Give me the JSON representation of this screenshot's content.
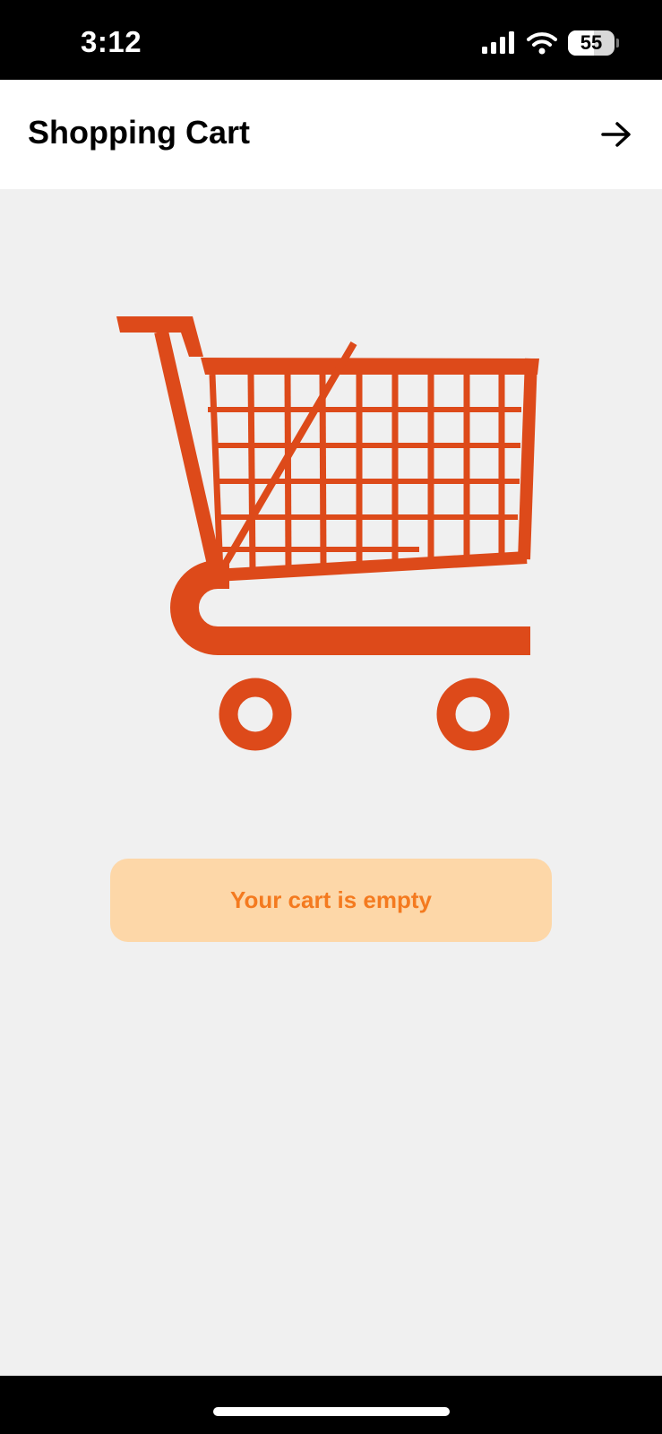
{
  "status_bar": {
    "time": "3:12",
    "battery_level": "55",
    "battery_fraction": 0.55,
    "icons": [
      "cellular-signal-icon",
      "wifi-icon",
      "battery-icon"
    ]
  },
  "header": {
    "title": "Shopping Cart",
    "action_icon": "arrow-right-icon"
  },
  "main": {
    "illustration_icon": "shopping-cart-icon",
    "empty_message": "Your cart is empty"
  },
  "colors": {
    "accent": "#dd4a1a",
    "banner_background": "#fdd7a8",
    "banner_text": "#f47a1f",
    "page_background": "#f0f0f0"
  }
}
